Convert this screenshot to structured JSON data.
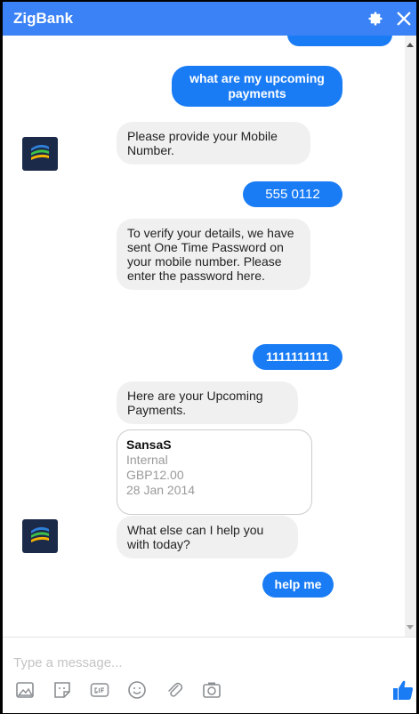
{
  "header": {
    "title": "ZigBank"
  },
  "messages": {
    "user_1": "what are my upcoming payments",
    "bot_1": "Please provide your Mobile Number.",
    "user_2": "555 0112",
    "bot_2": "To verify your details, we have sent One Time Password on your mobile number. Please enter the password here.",
    "user_3": "1111111111",
    "bot_3": "Here are your Upcoming Payments.",
    "bot_4": "What else can I help you with today?",
    "user_4": "help me"
  },
  "payment_card": {
    "name": "SansaS",
    "type": "Internal",
    "amount": "GBP12.00",
    "date": "28 Jan 2014"
  },
  "composer": {
    "placeholder": "Type a message..."
  },
  "colors": {
    "header": "#3b82f6",
    "user_bubble": "#1a7cf5",
    "bot_bubble": "#f1f0f0",
    "like": "#1a7cf5"
  },
  "icons": [
    "settings-gear-icon",
    "close-icon",
    "image-icon",
    "sticker-icon",
    "gif-icon",
    "emoji-icon",
    "attachment-icon",
    "camera-icon",
    "thumbs-up-icon"
  ]
}
